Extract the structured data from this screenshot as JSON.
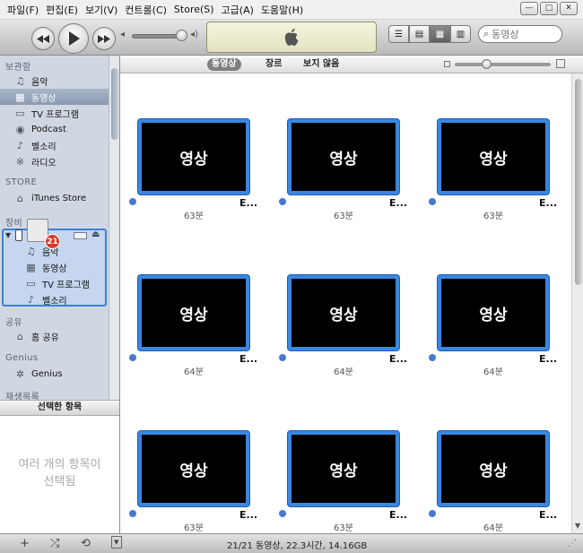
{
  "menu": [
    "파일(F)",
    "편집(E)",
    "보기(V)",
    "컨트롤(C)",
    "Store(S)",
    "고급(A)",
    "도움말(H)"
  ],
  "window_buttons": [
    "—",
    "□",
    "✕"
  ],
  "search": {
    "placeholder": "동영상"
  },
  "sidebar": {
    "library_header": "보관함",
    "library": [
      "음악",
      "동영상",
      "TV 프로그램",
      "Podcast",
      "벨소리",
      "라디오"
    ],
    "store_header": "STORE",
    "store": [
      "iTunes Store"
    ],
    "devices_header": "장비",
    "device_items": [
      "음악",
      "동영상",
      "TV 프로그램",
      "벨소리"
    ],
    "shared_header": "공유",
    "shared": [
      "홈 공유"
    ],
    "genius_header": "Genius",
    "genius": [
      "Genius"
    ],
    "playlists_header": "재생목록",
    "drag_badge": "21"
  },
  "selected_panel": {
    "title": "선택한 항목",
    "message_line1": "여러 개의 항목이",
    "message_line2": "선택됨"
  },
  "filters": [
    "동영상",
    "장르",
    "보지 않음"
  ],
  "videos": [
    {
      "thumb": "영상",
      "title": "E...",
      "duration": "63분"
    },
    {
      "thumb": "영상",
      "title": "E...",
      "duration": "63분"
    },
    {
      "thumb": "영상",
      "title": "E...",
      "duration": "63분"
    },
    {
      "thumb": "영상",
      "title": "E...",
      "duration": "64분"
    },
    {
      "thumb": "영상",
      "title": "E...",
      "duration": "64분"
    },
    {
      "thumb": "영상",
      "title": "E...",
      "duration": "64분"
    },
    {
      "thumb": "영상",
      "title": "E...",
      "duration": "63분"
    },
    {
      "thumb": "영상",
      "title": "E...",
      "duration": "63분"
    },
    {
      "thumb": "영상",
      "title": "E...",
      "duration": "64분"
    }
  ],
  "status": "21/21 동영상, 22.3시간, 14.16GB",
  "colors": {
    "thumb_border": "#3a86e0",
    "selection": "#8c9bb2",
    "device_highlight": "#3d7fd8"
  }
}
